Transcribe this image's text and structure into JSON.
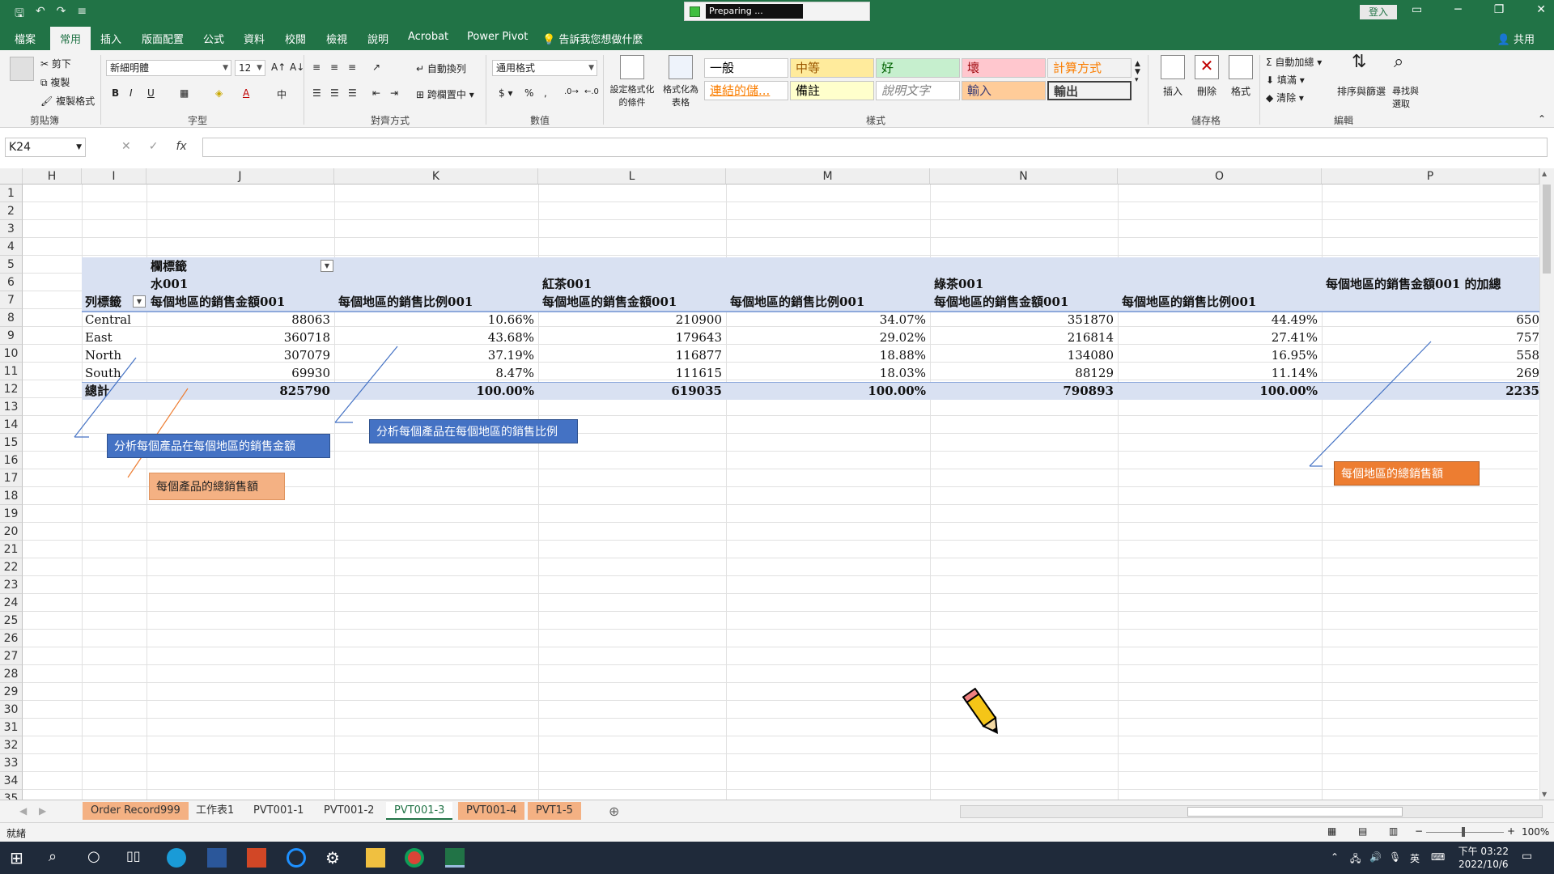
{
  "app": {
    "preparing_text": "Preparing ...",
    "signin_label": "登入",
    "share_label": "共用",
    "accent_color": "#217346"
  },
  "menu_tabs": [
    "檔案",
    "常用",
    "插入",
    "版面配置",
    "公式",
    "資料",
    "校閱",
    "檢視",
    "說明",
    "Acrobat",
    "Power Pivot",
    "告訴我您想做什麼"
  ],
  "ribbon": {
    "clipboard": {
      "cut": "剪下",
      "copy": "複製",
      "format_painter": "複製格式",
      "label": "剪貼簿"
    },
    "font": {
      "name": "新細明體",
      "size": "12",
      "label": "字型"
    },
    "alignment": {
      "wrap": "自動換列",
      "merge": "跨欄置中",
      "label": "對齊方式"
    },
    "number": {
      "format": "通用格式",
      "label": "數值"
    },
    "conditional": "設定格式化的條件",
    "as_table": "格式化為表格",
    "styles": {
      "label": "樣式",
      "items": [
        {
          "name": "一般",
          "bg": "#ffffff",
          "fg": "#000000"
        },
        {
          "name": "中等",
          "bg": "#ffeb9c",
          "fg": "#9c5700"
        },
        {
          "name": "好",
          "bg": "#c6efce",
          "fg": "#006100"
        },
        {
          "name": "壞",
          "bg": "#ffc7ce",
          "fg": "#9c0006"
        },
        {
          "name": "計算方式",
          "bg": "#f2f2f2",
          "fg": "#fa7d00"
        },
        {
          "name": "連結的儲...",
          "bg": "#ffffff",
          "fg": "#fa7d00"
        },
        {
          "name": "備註",
          "bg": "#ffffcc",
          "fg": "#000000"
        },
        {
          "name": "說明文字",
          "bg": "#ffffff",
          "fg": "#7f7f7f"
        },
        {
          "name": "輸入",
          "bg": "#ffcc99",
          "fg": "#3f3f76"
        },
        {
          "name": "輸出",
          "bg": "#f2f2f2",
          "fg": "#3f3f3f"
        }
      ]
    },
    "cells": {
      "insert": "插入",
      "delete": "刪除",
      "format": "格式",
      "label": "儲存格"
    },
    "editing": {
      "autosum": "自動加總",
      "fill": "填滿",
      "clear": "清除",
      "sort": "排序與篩選",
      "find": "尋找與選取",
      "label": "編輯"
    }
  },
  "formula_bar": {
    "name_box": "K24",
    "fx": "fx",
    "content": ""
  },
  "columns": [
    "H",
    "I",
    "J",
    "K",
    "L",
    "M",
    "N",
    "O",
    "P"
  ],
  "rows": [
    "1",
    "2",
    "3",
    "4",
    "5",
    "6",
    "7",
    "8",
    "9",
    "10",
    "11",
    "12",
    "13",
    "14",
    "15",
    "16",
    "17",
    "18",
    "19",
    "20",
    "21",
    "22",
    "23",
    "24",
    "25",
    "26",
    "27",
    "28",
    "29",
    "30",
    "31",
    "32",
    "33",
    "34",
    "35"
  ],
  "pivot": {
    "col_labels_header": "欄標籤",
    "row_labels_header": "列標籤",
    "groups": [
      "水001",
      "紅茶001",
      "綠茶001",
      "每個地區的銷售金額001 的加總"
    ],
    "measures": [
      "每個地區的銷售金額001",
      "每個地區的銷售比例001",
      "每個地區的銷售金額001",
      "每個地區的銷售比例001",
      "每個地區的銷售金額001",
      "每個地區的銷售比例001"
    ],
    "rows": [
      {
        "label": "Central",
        "vals": [
          "88063",
          "10.66%",
          "210900",
          "34.07%",
          "351870",
          "44.49%",
          "650"
        ]
      },
      {
        "label": "East",
        "vals": [
          "360718",
          "43.68%",
          "179643",
          "29.02%",
          "216814",
          "27.41%",
          "757"
        ]
      },
      {
        "label": "North",
        "vals": [
          "307079",
          "37.19%",
          "116877",
          "18.88%",
          "134080",
          "16.95%",
          "558"
        ]
      },
      {
        "label": "South",
        "vals": [
          "69930",
          "8.47%",
          "111615",
          "18.03%",
          "88129",
          "11.14%",
          "269"
        ]
      }
    ],
    "total": {
      "label": "總計",
      "vals": [
        "825790",
        "100.00%",
        "619035",
        "100.00%",
        "790893",
        "100.00%",
        "2235"
      ]
    }
  },
  "annotations": {
    "sales_amount": "分析每個產品在每個地區的銷售金額",
    "sales_ratio": "分析每個產品在每個地區的銷售比例",
    "product_total": "每個產品的總銷售額",
    "region_total": "每個地區的總銷售額"
  },
  "sheet_tabs": [
    "Order Record999",
    "工作表1",
    "PVT001-1",
    "PVT001-2",
    "PVT001-3",
    "PVT001-4",
    "PVT1-5"
  ],
  "status": {
    "ready": "就緒",
    "zoom": "100%"
  },
  "clock": {
    "time": "下午 03:22",
    "date": "2022/10/6"
  },
  "taskbar_lang": "英"
}
